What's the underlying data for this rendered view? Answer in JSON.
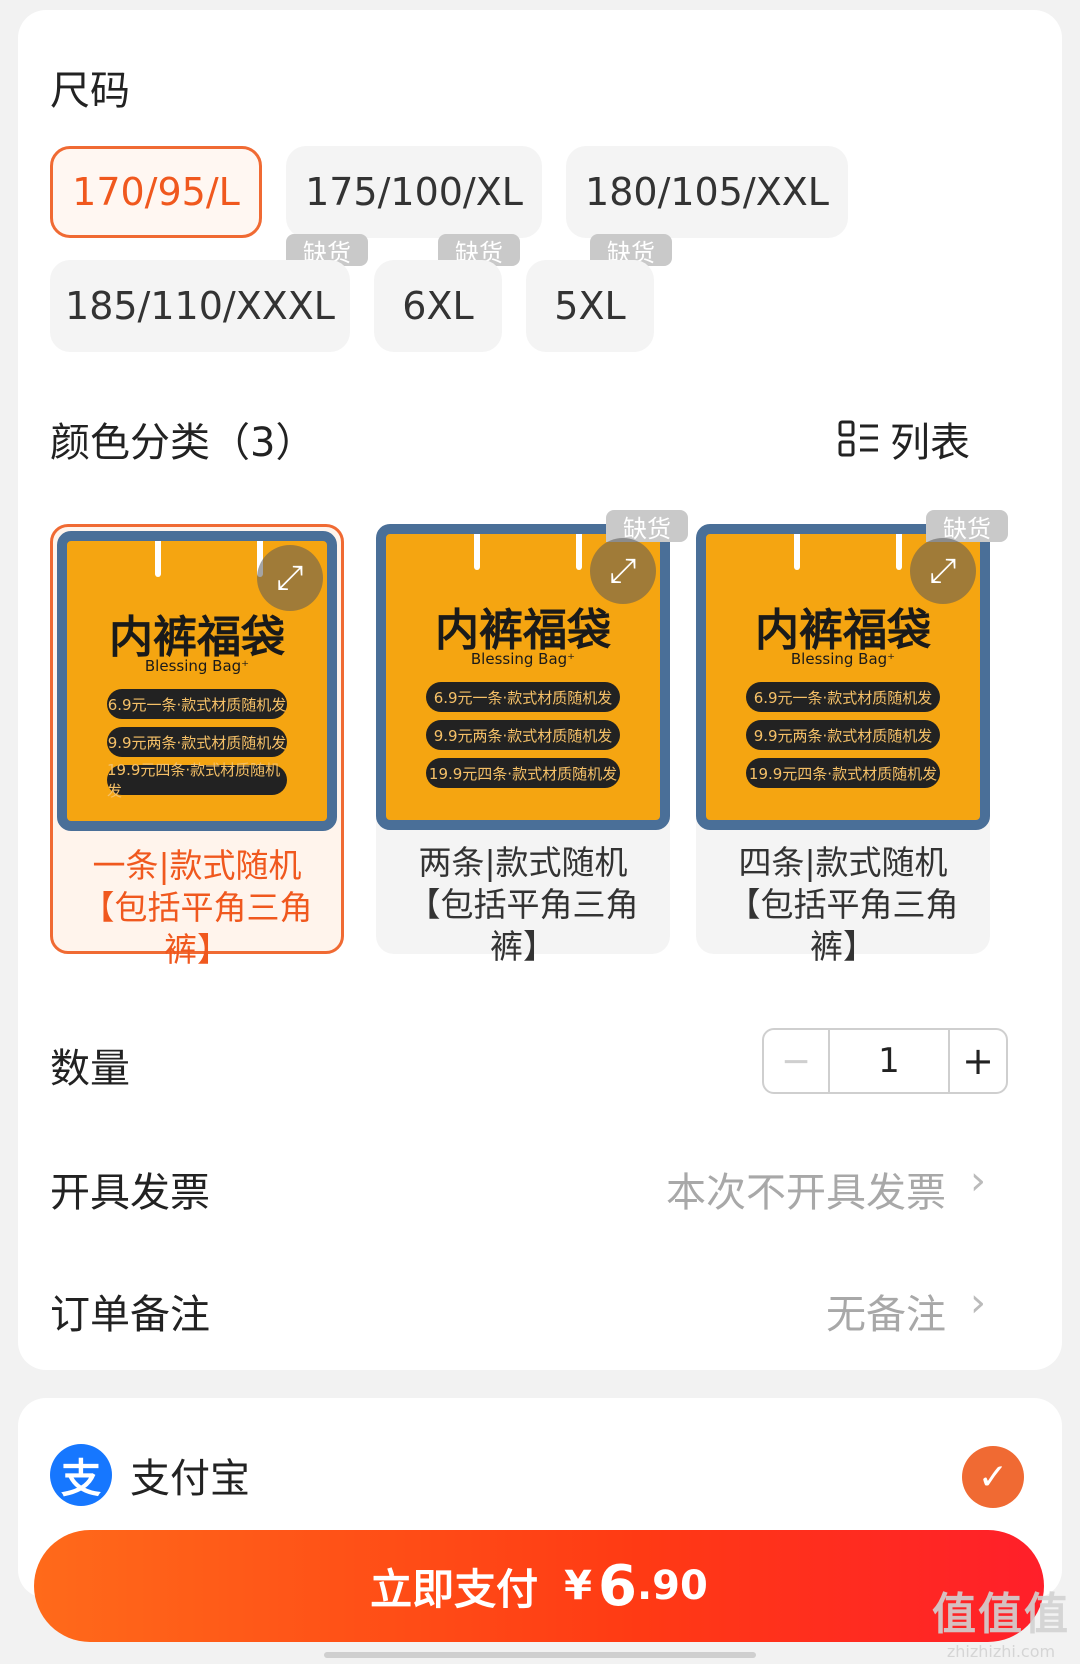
{
  "size": {
    "title": "尺码",
    "options": [
      {
        "label": "170/95/L",
        "selected": true,
        "out_of_stock": false
      },
      {
        "label": "175/100/XL",
        "selected": false,
        "out_of_stock": false
      },
      {
        "label": "180/105/XXL",
        "selected": false,
        "out_of_stock": false
      },
      {
        "label": "185/110/XXXL",
        "selected": false,
        "out_of_stock": false
      },
      {
        "label": "6XL",
        "selected": false,
        "out_of_stock": true
      },
      {
        "label": "5XL",
        "selected": false,
        "out_of_stock": true
      }
    ],
    "badges": [
      "缺货",
      "缺货",
      "缺货"
    ]
  },
  "color": {
    "title": "颜色分类（3）",
    "view_toggle_label": "列表",
    "items": [
      {
        "label": "一条|款式随机【包括平角三角裤】",
        "selected": true,
        "out_of_stock": false
      },
      {
        "label": "两条|款式随机【包括平角三角裤】",
        "selected": false,
        "out_of_stock": true,
        "badge": "缺货"
      },
      {
        "label": "四条|款式随机【包括平角三角裤】",
        "selected": false,
        "out_of_stock": true,
        "badge": "缺货"
      }
    ],
    "thumbnail": {
      "title": "内裤福袋",
      "subtitle": "Blessing Bag⁺",
      "lines": [
        "6.9元一条·款式材质随机发",
        "9.9元两条·款式材质随机发",
        "19.9元四条·款式材质随机发"
      ]
    }
  },
  "quantity": {
    "label": "数量",
    "value": "1",
    "minus": "−",
    "plus": "+"
  },
  "invoice": {
    "label": "开具发票",
    "value": "本次不开具发票"
  },
  "remark": {
    "label": "订单备注",
    "value": "无备注"
  },
  "payment": {
    "method": "支付宝",
    "icon": "alipay-icon",
    "selected": true
  },
  "pay_button": {
    "label": "立即支付",
    "currency": "¥",
    "integer": "6",
    "decimal": ".90"
  },
  "watermark": {
    "main": "值值值",
    "sub": "zhizhizhi.com"
  },
  "colors": {
    "accent": "#f06a33",
    "pay_gradient_start": "#ff6a1a",
    "pay_gradient_end": "#ff1f2a",
    "alipay_blue": "#1677ff"
  }
}
